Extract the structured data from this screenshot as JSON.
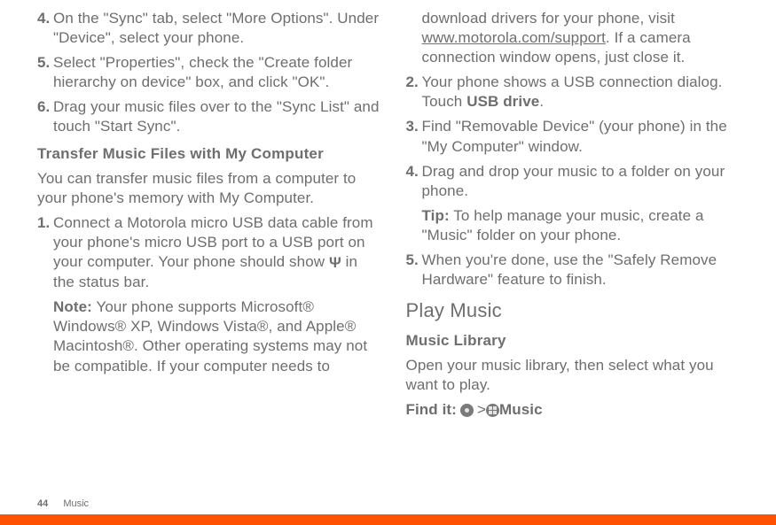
{
  "left": {
    "step4": {
      "num": "4.",
      "text": "On the \"Sync\" tab, select \"More Options\". Under \"Device\", select your phone."
    },
    "step5": {
      "num": "5.",
      "text": "Select \"Properties\", check the \"Create folder hierarchy on device\" box, and click \"OK\"."
    },
    "step6": {
      "num": "6.",
      "text": "Drag your music files over to the \"Sync List\" and touch \"Start Sync\"."
    },
    "transferHeading": "Transfer Music Files with My Computer",
    "transferIntro": "You can transfer music files from a computer to your phone's memory with My Computer.",
    "c1": {
      "num": "1.",
      "textA": "Connect a Motorola micro USB data cable from your phone's micro USB port to a USB port on your computer. Your phone should show ",
      "textB": " in the status bar.",
      "noteLabel": "Note:",
      "noteText": " Your phone supports Microsoft® Windows® XP, Windows Vista®, and Apple® Macintosh®. Other operating systems may not be compatible. If your computer needs to "
    }
  },
  "right": {
    "contA": "download drivers for your phone, visit ",
    "link": "www.motorola.com/support",
    "contB": ". If a camera connection window opens, just close it.",
    "r2": {
      "num": "2.",
      "textA": "Your phone shows a USB connection dialog. Touch ",
      "usb": "USB drive",
      "textB": "."
    },
    "r3": {
      "num": "3.",
      "text": "Find \"Removable Device\" (your phone) in the \"My Computer\" window."
    },
    "r4": {
      "num": "4.",
      "text": "Drag and drop your music to a folder on your phone.",
      "tipLabel": "Tip:",
      "tipText": " To help manage your music, create a \"Music\" folder on your phone."
    },
    "r5": {
      "num": "5.",
      "text": "When you're done, use the \"Safely Remove Hardware\" feature to finish."
    },
    "playHeading": "Play Music",
    "libraryHeading": "Music Library",
    "libraryText": "Open your music library, then select what you want to play.",
    "findLabel": "Find it: ",
    "gt": " > ",
    "musicLabel": " Music"
  },
  "footer": {
    "pageNum": "44",
    "section": "Music"
  }
}
